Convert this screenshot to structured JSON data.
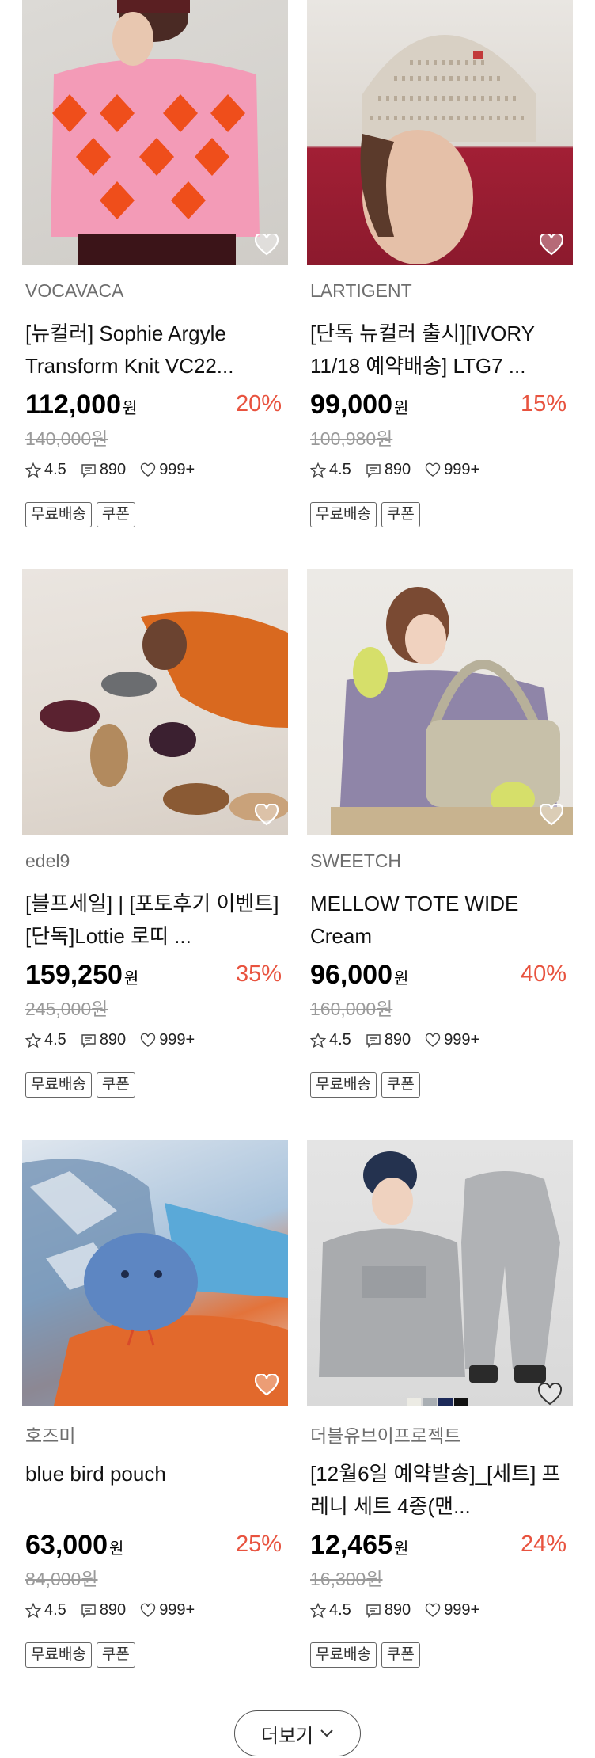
{
  "products": [
    {
      "brand": "VOCAVACA",
      "title": "[뉴컬러] Sophie Argyle Transform Knit VC22...",
      "price": "112,000",
      "currency": "원",
      "discount": "20%",
      "original_price": "140,000원",
      "rating": "4.5",
      "reviews": "890",
      "likes": "999+",
      "tags": [
        "무료배송",
        "쿠폰"
      ],
      "image": "pink argyle knit sweater on model"
    },
    {
      "brand": "LARTIGENT",
      "title": "[단독 뉴컬러 출시][IVORY 11/18 예약배송] LTG7 ...",
      "price": "99,000",
      "currency": "원",
      "discount": "15%",
      "original_price": "100,980원",
      "rating": "4.5",
      "reviews": "890",
      "likes": "999+",
      "tags": [
        "무료배송",
        "쿠폰"
      ],
      "image": "ivory chunky knit beanie"
    },
    {
      "brand": "edel9",
      "title": "[블프세일] | [포토후기 이벤트] [단독]Lottie 로띠 ...",
      "price": "159,250",
      "currency": "원",
      "discount": "35%",
      "original_price": "245,000원",
      "rating": "4.5",
      "reviews": "890",
      "likes": "999+",
      "tags": [
        "무료배송",
        "쿠폰"
      ],
      "image": "mary jane flats on bed"
    },
    {
      "brand": "SWEETCH",
      "title": "MELLOW TOTE WIDE Cream",
      "price": "96,000",
      "currency": "원",
      "discount": "40%",
      "original_price": "160,000원",
      "rating": "4.5",
      "reviews": "890",
      "likes": "999+",
      "tags": [
        "무료배송",
        "쿠폰"
      ],
      "image": "cream padded tote bag"
    },
    {
      "brand": "호즈미",
      "title": "blue bird pouch",
      "price": "63,000",
      "currency": "원",
      "discount": "25%",
      "original_price": "84,000원",
      "rating": "4.5",
      "reviews": "890",
      "likes": "999+",
      "tags": [
        "무료배송",
        "쿠폰"
      ],
      "image": "blue furry bird pouch"
    },
    {
      "brand": "더블유브이프로젝트",
      "title": "[12월6일 예약발송]_[세트] 프레니 세트 4종(맨...",
      "price": "12,465",
      "currency": "원",
      "discount": "24%",
      "original_price": "16,300원",
      "rating": "4.5",
      "reviews": "890",
      "likes": "999+",
      "tags": [
        "무료배송",
        "쿠폰"
      ],
      "image": "grey sweatshirt and jogger set",
      "swatches": [
        "#ecebe4",
        "#a9aeb3",
        "#1d2a59",
        "#111111"
      ]
    }
  ],
  "more_button": {
    "label": "더보기"
  },
  "colors": {
    "discount": "#e8533f",
    "muted": "#9a9a9a",
    "brand": "#6e6e6e"
  },
  "icons": {
    "heart": "heart-outline-icon",
    "star": "star-icon",
    "review": "comment-icon",
    "like": "heart-small-icon",
    "chevron": "chevron-down-icon"
  }
}
